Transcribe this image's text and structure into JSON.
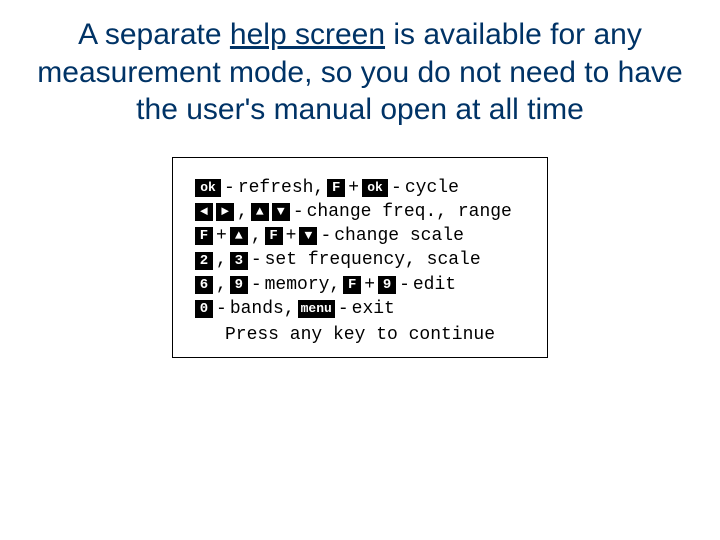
{
  "caption": {
    "pre": "A separate ",
    "u": "help screen",
    "post": " is available for any measurement mode, so you do not need to have the user's manual open at all time"
  },
  "keys": {
    "ok": "ok",
    "F": "F",
    "left": "◄",
    "right": "►",
    "up": "▲",
    "down": "▼",
    "n2": "2",
    "n3": "3",
    "n6": "6",
    "n9": "9",
    "n0": "0",
    "menu": "menu"
  },
  "text": {
    "dash": " - ",
    "comma": ",",
    "plus": "+",
    "refresh": "refresh, ",
    "cycle": "cycle",
    "change_freq_range": "change freq., range",
    "change_scale": "change scale",
    "set_freq_scale": "set frequency, scale",
    "memory": "memory, ",
    "edit": "edit",
    "bands": "bands, ",
    "exit": "exit",
    "press": "Press any key to continue"
  }
}
